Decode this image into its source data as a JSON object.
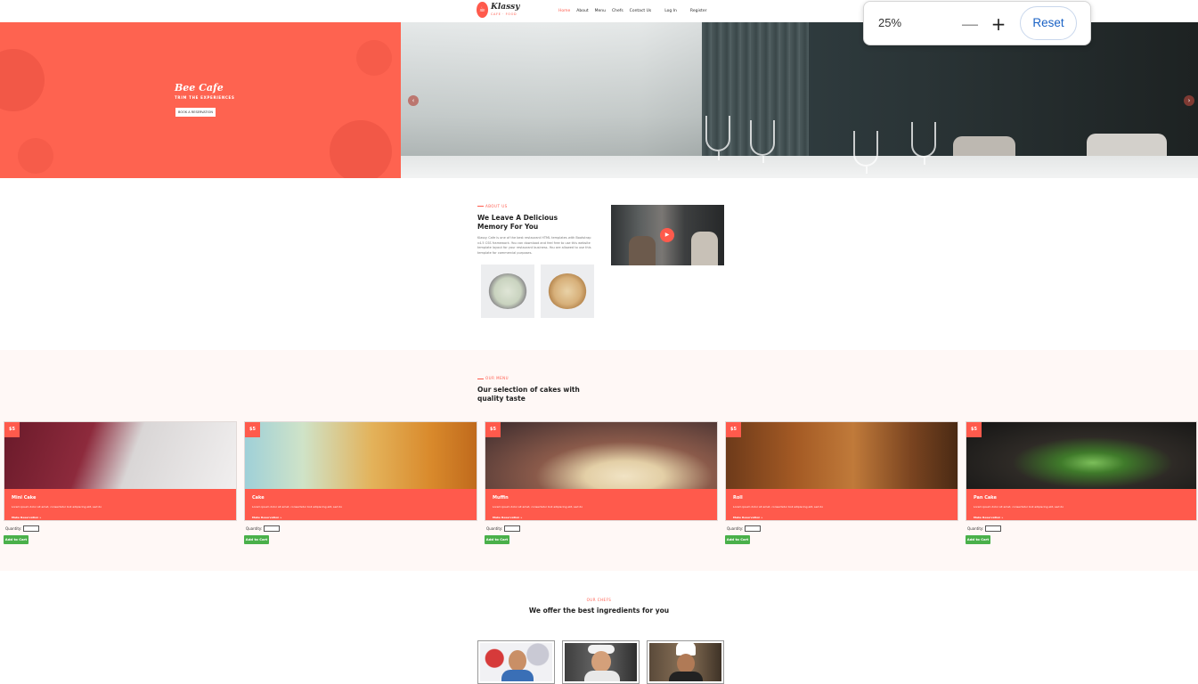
{
  "nav": {
    "logo_name": "Klassy",
    "logo_sub": "CAFE · FOOD",
    "links": [
      "Home",
      "About",
      "Menu",
      "Chefs",
      "Contact Us"
    ],
    "login": "Log In",
    "register": "Register"
  },
  "zoom": {
    "level": "25%",
    "minus": "—",
    "plus": "+",
    "reset": "Reset"
  },
  "hero": {
    "title": "Bee Cafe",
    "subtitle": "TRIM THE EXPERIENCES",
    "button": "BOOK A RESERVATION",
    "prev": "‹",
    "next": "›"
  },
  "about": {
    "kicker": "ABOUT US",
    "title": "We Leave A Delicious Memory For You",
    "body": "Klassy Cafe is one of the best restaurant HTML templates with Bootstrap v4.5 CSS framework. You can download and feel free to use this website template layout for your restaurant business. You are allowed to use this template for commercial purposes.",
    "play": "▶"
  },
  "menu": {
    "kicker": "OUR MENU",
    "title": "Our selection of cakes with quality taste",
    "quantity_label": "Quantity:",
    "add_label": "Add to Cart",
    "items": [
      {
        "price": "$5",
        "name": "Mini Cake",
        "desc": "Lorem ipsum dolor sit amet, consectetur boli adipiscing elit, sed do",
        "note": "Make Reservation »"
      },
      {
        "price": "$5",
        "name": "Cake",
        "desc": "Lorem ipsum dolor sit amet, consectetur boli adipiscing elit, sed do",
        "note": "Make Reservation »"
      },
      {
        "price": "$5",
        "name": "Muffin",
        "desc": "Lorem ipsum dolor sit amet, consectetur boli adipiscing elit, sed do",
        "note": "Make Reservation »"
      },
      {
        "price": "$5",
        "name": "Roll",
        "desc": "Lorem ipsum dolor sit amet, consectetur boli adipiscing elit, sed do",
        "note": "Make Reservation »"
      },
      {
        "price": "$5",
        "name": "Pan Cake",
        "desc": "Lorem ipsum dolor sit amet, consectetur boli adipiscing elit, sed do",
        "note": "Make Reservation »"
      }
    ]
  },
  "chefs": {
    "kicker": "OUR CHEFS",
    "title": "We offer the best ingredients for you"
  },
  "colors": {
    "accent": "#ff5a4c",
    "button_green": "#4ab04a",
    "zoom_reset_text": "#1a62c5"
  }
}
